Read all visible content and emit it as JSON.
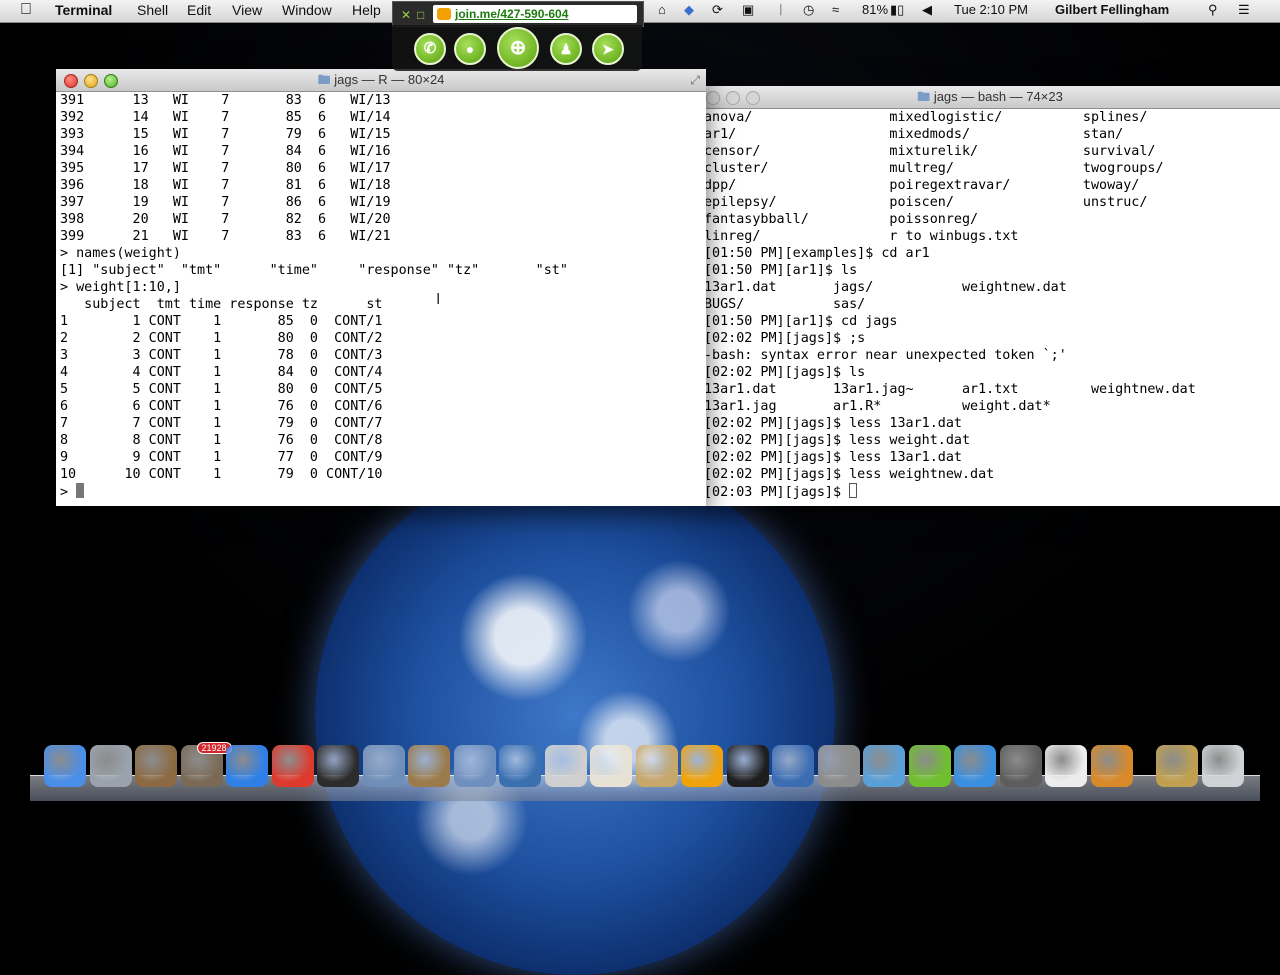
{
  "menubar": {
    "app_name": "Terminal",
    "menus": [
      "Shell",
      "Edit",
      "View",
      "Window",
      "Help"
    ],
    "battery": "81%",
    "clock": "Tue 2:10 PM",
    "user": "Gilbert Fellingham"
  },
  "joinme": {
    "url": "join.me/427-590-604",
    "buttons": [
      "phone",
      "chat",
      "zoom",
      "people",
      "pointer"
    ]
  },
  "r_window": {
    "title": "jags — R — 80×24",
    "lines": [
      "391      13   WI    7       83  6   WI/13",
      "392      14   WI    7       85  6   WI/14",
      "393      15   WI    7       79  6   WI/15",
      "394      16   WI    7       84  6   WI/16",
      "395      17   WI    7       80  6   WI/17",
      "396      18   WI    7       81  6   WI/18",
      "397      19   WI    7       86  6   WI/19",
      "398      20   WI    7       82  6   WI/20",
      "399      21   WI    7       83  6   WI/21",
      "> names(weight)",
      "[1] \"subject\"  \"tmt\"      \"time\"     \"response\" \"tz\"       \"st\"",
      "> weight[1:10,]",
      "   subject  tmt time response tz      st",
      "1        1 CONT    1       85  0  CONT/1",
      "2        2 CONT    1       80  0  CONT/2",
      "3        3 CONT    1       78  0  CONT/3",
      "4        4 CONT    1       84  0  CONT/4",
      "5        5 CONT    1       80  0  CONT/5",
      "6        6 CONT    1       76  0  CONT/6",
      "7        7 CONT    1       79  0  CONT/7",
      "8        8 CONT    1       76  0  CONT/8",
      "9        9 CONT    1       77  0  CONT/9",
      "10      10 CONT    1       79  0 CONT/10"
    ],
    "prompt": "> "
  },
  "bash_window": {
    "title": "jags — bash — 74×23",
    "lines": [
      "anova/                 mixedlogistic/          splines/",
      "ar1/                   mixedmods/              stan/",
      "censor/                mixturelik/             survival/",
      "cluster/               multreg/                twogroups/",
      "dpp/                   poiregextravar/         twoway/",
      "epilepsy/              poiscen/                unstruc/",
      "fantasybball/          poissonreg/",
      "linreg/                r to winbugs.txt",
      "[01:50 PM][examples]$ cd ar1",
      "[01:50 PM][ar1]$ ls",
      "13ar1.dat       jags/           weightnew.dat",
      "BUGS/           sas/",
      "[01:50 PM][ar1]$ cd jags",
      "[02:02 PM][jags]$ ;s",
      "-bash: syntax error near unexpected token `;'",
      "[02:02 PM][jags]$ ls",
      "13ar1.dat       13ar1.jag~      ar1.txt         weightnew.dat",
      "13ar1.jag       ar1.R*          weight.dat*",
      "[02:02 PM][jags]$ less 13ar1.dat",
      "[02:02 PM][jags]$ less weight.dat",
      "[02:02 PM][jags]$ less 13ar1.dat",
      "[02:02 PM][jags]$ less weightnew.dat",
      "[02:03 PM][jags]$ "
    ]
  },
  "dock": {
    "mail_badge": "21928",
    "apps": [
      {
        "name": "finder",
        "color": "#4a8ee8"
      },
      {
        "name": "launchpad",
        "color": "#9aa3ad"
      },
      {
        "name": "image-capture",
        "color": "#8b6a43"
      },
      {
        "name": "mail-stamp",
        "color": "#7a6a55"
      },
      {
        "name": "app-store",
        "color": "#2f7fe6"
      },
      {
        "name": "chrome",
        "color": "#dd3a2e"
      },
      {
        "name": "dashboard",
        "color": "#2c2c2c"
      },
      {
        "name": "preview",
        "color": "#6f8fb8"
      },
      {
        "name": "gimp",
        "color": "#9b7b4b"
      },
      {
        "name": "r",
        "color": "#6f8fbf"
      },
      {
        "name": "pandora",
        "color": "#3a6fb0"
      },
      {
        "name": "latex",
        "color": "#cfcfcf"
      },
      {
        "name": "textedit",
        "color": "#e7e2d4"
      },
      {
        "name": "contacts",
        "color": "#c8a76a"
      },
      {
        "name": "joinme",
        "color": "#f0a20a"
      },
      {
        "name": "terminal",
        "color": "#1e1e1e"
      },
      {
        "name": "virtualbox",
        "color": "#3b6db3"
      },
      {
        "name": "system-preferences",
        "color": "#8c8c8c"
      },
      {
        "name": "wordpress",
        "color": "#5aa0d8"
      },
      {
        "name": "x-app",
        "color": "#6fbf2e"
      },
      {
        "name": "itunes",
        "color": "#3b8fe0"
      },
      {
        "name": "facetime",
        "color": "#5d5d5d"
      },
      {
        "name": "file-doc",
        "color": "#ededed"
      },
      {
        "name": "x11",
        "color": "#d88a2a"
      },
      {
        "name": "stack-folder",
        "color": "#c0a050"
      },
      {
        "name": "trash",
        "color": "#cfd3d6"
      }
    ]
  }
}
